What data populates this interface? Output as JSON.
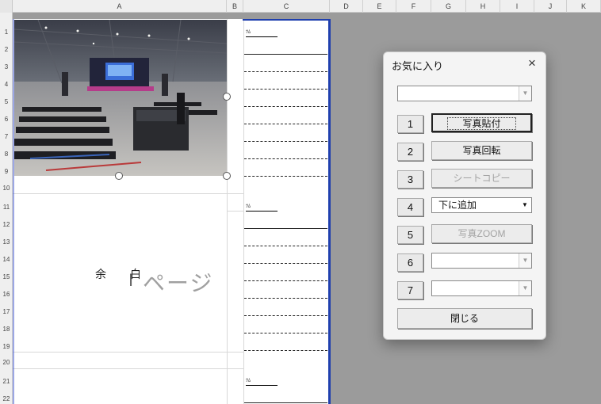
{
  "sheet": {
    "columns": [
      "A",
      "B",
      "C",
      "D",
      "E",
      "F",
      "G",
      "H",
      "I",
      "J",
      "K"
    ],
    "rows": [
      "1",
      "2",
      "3",
      "4",
      "5",
      "6",
      "7",
      "8",
      "9",
      "10",
      "11",
      "12",
      "13",
      "14",
      "15",
      "16",
      "17",
      "18",
      "19",
      "20",
      "21",
      "22"
    ],
    "margin_text_1": "余",
    "margin_text_2": "白",
    "page_text": "ページ",
    "line_marks": [
      "ﾂﾑ",
      "ﾂﾑ",
      "ﾂﾑ"
    ]
  },
  "dialog": {
    "title": "お気に入り",
    "close_icon": "×",
    "rows": [
      {
        "num": "1",
        "label": "写真貼付",
        "state": "focused"
      },
      {
        "num": "2",
        "label": "写真回転",
        "state": "enabled"
      },
      {
        "num": "3",
        "label": "シートコピー",
        "state": "disabled"
      },
      {
        "num": "4",
        "label": "下に追加",
        "state": "combo"
      },
      {
        "num": "5",
        "label": "写真ZOOM",
        "state": "disabled"
      },
      {
        "num": "6",
        "label": "",
        "state": "combo-disabled"
      },
      {
        "num": "7",
        "label": "",
        "state": "combo-disabled"
      }
    ],
    "close_label": "閉じる",
    "dropdown_arrow": "▼"
  }
}
